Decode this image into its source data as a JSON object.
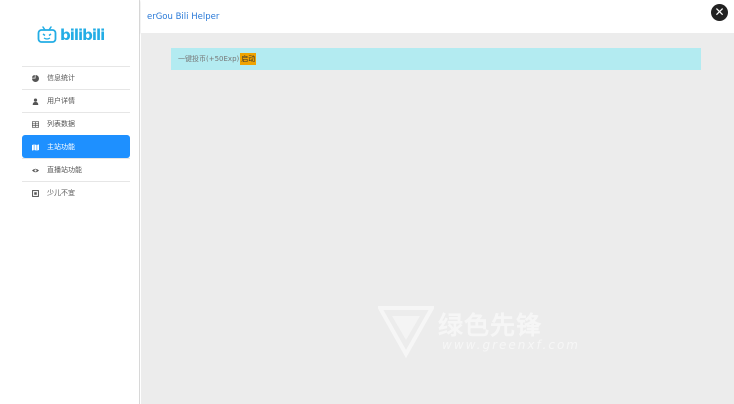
{
  "sidebar": {
    "logo_text": "bilibili",
    "items": [
      {
        "label": "信息统计",
        "icon": "pie-chart-icon",
        "active": false
      },
      {
        "label": "用户详情",
        "icon": "user-icon",
        "active": false
      },
      {
        "label": "列表数据",
        "icon": "table-icon",
        "active": false
      },
      {
        "label": "主站功能",
        "icon": "map-icon",
        "active": true
      },
      {
        "label": "直播站功能",
        "icon": "eye-icon",
        "active": false
      },
      {
        "label": "少儿不宜",
        "icon": "square-icon",
        "active": false
      }
    ]
  },
  "header": {
    "title": "erGou Bili Helper",
    "close_icon": "close-icon"
  },
  "main": {
    "alert_text": "一键投币(+50Exp)",
    "alert_button": "启动"
  },
  "watermark": {
    "text": "绿色先锋",
    "url": "www.greenxf.com"
  },
  "colors": {
    "accent": "#1e90ff",
    "title": "#2a7ad8",
    "alert_bg": "#b3ebf1",
    "button": "#f0a300",
    "content_bg": "#ececec",
    "logo": "#23ade5"
  }
}
